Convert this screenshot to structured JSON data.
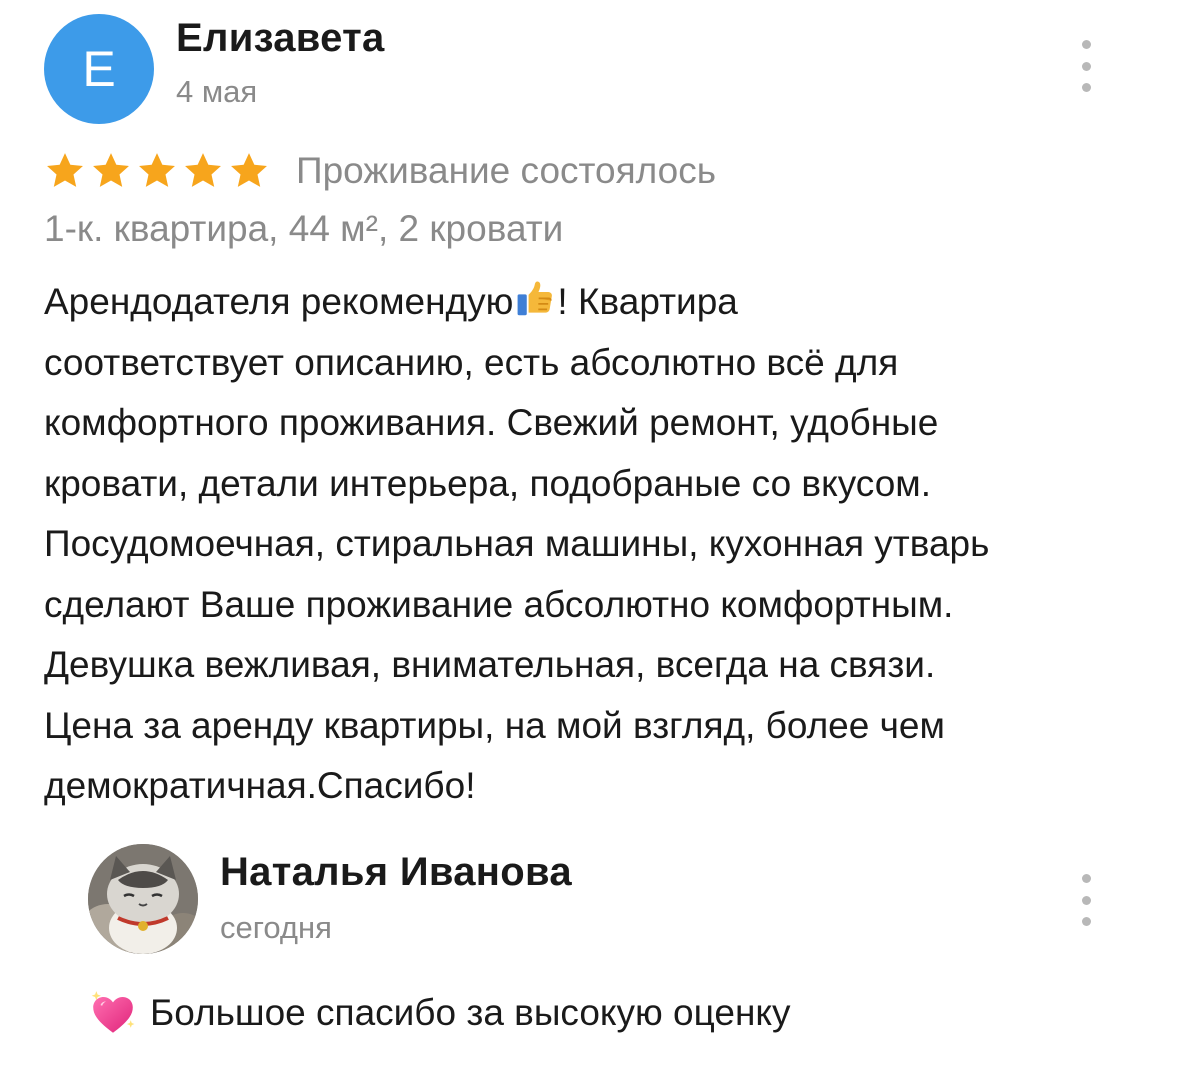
{
  "review": {
    "author_initial": "Е",
    "author_name": "Елизавета",
    "date": "4 мая",
    "rating": 5,
    "rating_max": 5,
    "stay_status": "Проживание состоялось",
    "listing": "1-к. квартира, 44 м², 2 кровати",
    "text_lines": [
      "Арендодателя рекомендую",
      "! Квартира",
      "соответствует описанию, есть абсолютно всё для",
      "комфортного проживания. Свежий ремонт, удобные",
      "кровати, детали интерьера, подобраные со вкусом.",
      "Посудомоечная, стиральная машины, кухонная утварь",
      "сделают Ваше проживание абсолютно комфортным.",
      "Девушка вежливая, внимательная, всегда на связи.",
      "Цена за аренду квартиры, на мой взгляд, более чем",
      "демократичная.Спасибо!"
    ],
    "icons": {
      "avatar_color": "#3d9be9",
      "star": "star-icon",
      "star_color": "#f7a51c",
      "emoji": "thumbs-up-icon",
      "menu": "kebab-menu-icon"
    }
  },
  "reply": {
    "author_name": "Наталья Иванова",
    "date": "сегодня",
    "text": "Большое спасибо за высокую оценку",
    "icons": {
      "avatar": "cat-photo-avatar",
      "emoji": "sparkling-heart-icon",
      "menu": "kebab-menu-icon"
    }
  },
  "colors": {
    "primary_text": "#1a1a1a",
    "secondary_text": "#8a8a8a",
    "menu_dots": "#b8b8b8"
  }
}
